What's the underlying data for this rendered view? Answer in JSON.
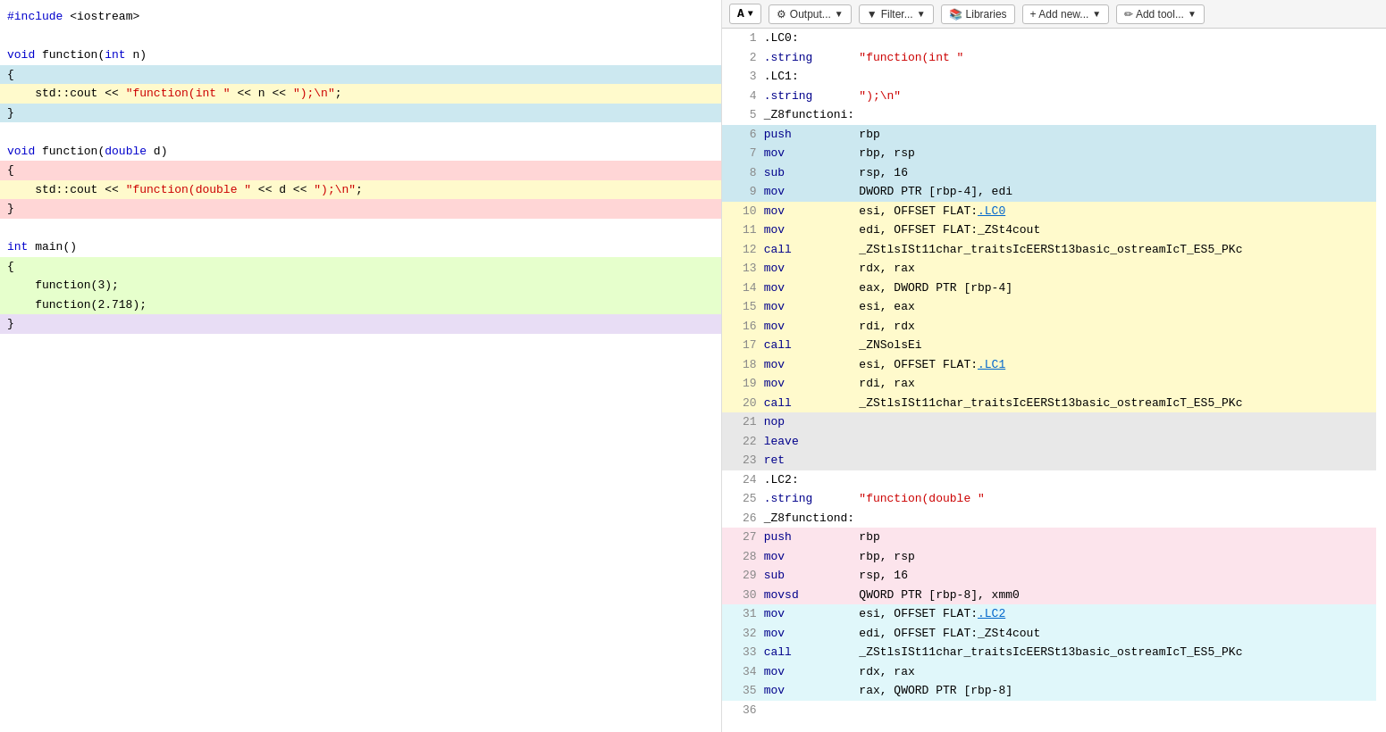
{
  "left": {
    "lines": [
      {
        "text": "#include <iostream>",
        "highlight": "",
        "parts": [
          {
            "t": "#include ",
            "cls": "kw"
          },
          {
            "t": "<iostream>",
            "cls": "plain"
          }
        ]
      },
      {
        "text": "",
        "highlight": ""
      },
      {
        "text": "void function(int n)",
        "highlight": "",
        "parts": [
          {
            "t": "void ",
            "cls": "kw"
          },
          {
            "t": "function(",
            "cls": "plain"
          },
          {
            "t": "int",
            "cls": "kw"
          },
          {
            "t": " n)",
            "cls": "plain"
          }
        ]
      },
      {
        "text": "{",
        "highlight": "hl-blue"
      },
      {
        "text": "    std::cout << \"function(int \" << n << \");\\n\";",
        "highlight": "hl-yellow",
        "parts": [
          {
            "t": "    std::cout << ",
            "cls": "plain"
          },
          {
            "t": "\"function(int \"",
            "cls": "str"
          },
          {
            "t": " << n << ",
            "cls": "plain"
          },
          {
            "t": "\");\\n\"",
            "cls": "str"
          },
          {
            "t": ";",
            "cls": "plain"
          }
        ]
      },
      {
        "text": "}",
        "highlight": "hl-blue"
      },
      {
        "text": "",
        "highlight": ""
      },
      {
        "text": "void function(double d)",
        "highlight": "",
        "parts": [
          {
            "t": "void ",
            "cls": "kw"
          },
          {
            "t": "function(",
            "cls": "plain"
          },
          {
            "t": "double",
            "cls": "kw"
          },
          {
            "t": " d)",
            "cls": "plain"
          }
        ]
      },
      {
        "text": "{",
        "highlight": "hl-red"
      },
      {
        "text": "    std::cout << \"function(double \" << d << \");\\n\";",
        "highlight": "hl-yellow",
        "parts": [
          {
            "t": "    std::cout << ",
            "cls": "plain"
          },
          {
            "t": "\"function(double \"",
            "cls": "str"
          },
          {
            "t": " << d << ",
            "cls": "plain"
          },
          {
            "t": "\");\\n\"",
            "cls": "str"
          },
          {
            "t": ";",
            "cls": "plain"
          }
        ]
      },
      {
        "text": "}",
        "highlight": "hl-red"
      },
      {
        "text": "",
        "highlight": ""
      },
      {
        "text": "int main()",
        "highlight": "",
        "parts": [
          {
            "t": "int ",
            "cls": "kw"
          },
          {
            "t": "main()",
            "cls": "plain"
          }
        ]
      },
      {
        "text": "{",
        "highlight": "hl-green"
      },
      {
        "text": "    function(3);",
        "highlight": "hl-green"
      },
      {
        "text": "    function(2.718);",
        "highlight": "hl-green"
      },
      {
        "text": "}",
        "highlight": "hl-purple"
      }
    ]
  },
  "toolbar": {
    "font_label": "A",
    "output_label": "Output...",
    "filter_label": "Filter...",
    "libraries_label": "Libraries",
    "add_new_label": "+ Add new...",
    "add_tool_label": "✏ Add tool..."
  },
  "asm": {
    "rows": [
      {
        "num": 1,
        "label": ".LC0:",
        "instr": "",
        "ops": "",
        "hl": ""
      },
      {
        "num": 2,
        "label": "",
        "instr": ".string",
        "ops": "\"function(int \"",
        "hl": "",
        "ops_is_str": true
      },
      {
        "num": 3,
        "label": ".LC1:",
        "instr": "",
        "ops": "",
        "hl": ""
      },
      {
        "num": 4,
        "label": "",
        "instr": ".string",
        "ops": "\");\\n\"",
        "hl": "",
        "ops_is_str": true
      },
      {
        "num": 5,
        "label": "_Z8functioni:",
        "instr": "",
        "ops": "",
        "hl": ""
      },
      {
        "num": 6,
        "label": "",
        "instr": "push",
        "ops": "rbp",
        "hl": "asm-hl-blue"
      },
      {
        "num": 7,
        "label": "",
        "instr": "mov",
        "ops": "rbp, rsp",
        "hl": "asm-hl-blue"
      },
      {
        "num": 8,
        "label": "",
        "instr": "sub",
        "ops": "rsp, 16",
        "hl": "asm-hl-blue"
      },
      {
        "num": 9,
        "label": "",
        "instr": "mov",
        "ops": "DWORD PTR [rbp-4], edi",
        "hl": "asm-hl-blue"
      },
      {
        "num": 10,
        "label": "",
        "instr": "mov",
        "ops": "esi, OFFSET FLAT:.LC0",
        "hl": "asm-hl-yellow",
        "link_in_ops": true,
        "link_text": ".LC0",
        "link_pos": "after_flat"
      },
      {
        "num": 11,
        "label": "",
        "instr": "mov",
        "ops": "edi, OFFSET FLAT:_ZSt4cout",
        "hl": "asm-hl-yellow"
      },
      {
        "num": 12,
        "label": "",
        "instr": "call",
        "ops": "_ZStlsISt11char_traitsIcEERSt13basic_ostreamIcT_ES5_PKc",
        "hl": "asm-hl-yellow"
      },
      {
        "num": 13,
        "label": "",
        "instr": "mov",
        "ops": "rdx, rax",
        "hl": "asm-hl-yellow"
      },
      {
        "num": 14,
        "label": "",
        "instr": "mov",
        "ops": "eax, DWORD PTR [rbp-4]",
        "hl": "asm-hl-yellow"
      },
      {
        "num": 15,
        "label": "",
        "instr": "mov",
        "ops": "esi, eax",
        "hl": "asm-hl-yellow"
      },
      {
        "num": 16,
        "label": "",
        "instr": "mov",
        "ops": "rdi, rdx",
        "hl": "asm-hl-yellow"
      },
      {
        "num": 17,
        "label": "",
        "instr": "call",
        "ops": "_ZNSolsEi",
        "hl": "asm-hl-yellow"
      },
      {
        "num": 18,
        "label": "",
        "instr": "mov",
        "ops": "esi, OFFSET FLAT:.LC1",
        "hl": "asm-hl-yellow",
        "link_in_ops": true,
        "link_text": ".LC1"
      },
      {
        "num": 19,
        "label": "",
        "instr": "mov",
        "ops": "rdi, rax",
        "hl": "asm-hl-yellow"
      },
      {
        "num": 20,
        "label": "",
        "instr": "call",
        "ops": "_ZStlsISt11char_traitsIcEERSt13basic_ostreamIcT_ES5_PKc",
        "hl": "asm-hl-yellow"
      },
      {
        "num": 21,
        "label": "",
        "instr": "nop",
        "ops": "",
        "hl": "asm-hl-gray"
      },
      {
        "num": 22,
        "label": "",
        "instr": "leave",
        "ops": "",
        "hl": "asm-hl-gray"
      },
      {
        "num": 23,
        "label": "",
        "instr": "ret",
        "ops": "",
        "hl": "asm-hl-gray"
      },
      {
        "num": 24,
        "label": ".LC2:",
        "instr": "",
        "ops": "",
        "hl": ""
      },
      {
        "num": 25,
        "label": "",
        "instr": ".string",
        "ops": "\"function(double \"",
        "hl": "",
        "ops_is_str": true
      },
      {
        "num": 26,
        "label": "_Z8functiond:",
        "instr": "",
        "ops": "",
        "hl": ""
      },
      {
        "num": 27,
        "label": "",
        "instr": "push",
        "ops": "rbp",
        "hl": "asm-hl-pink"
      },
      {
        "num": 28,
        "label": "",
        "instr": "mov",
        "ops": "rbp, rsp",
        "hl": "asm-hl-pink"
      },
      {
        "num": 29,
        "label": "",
        "instr": "sub",
        "ops": "rsp, 16",
        "hl": "asm-hl-pink"
      },
      {
        "num": 30,
        "label": "",
        "instr": "movsd",
        "ops": "QWORD PTR [rbp-8], xmm0",
        "hl": "asm-hl-pink"
      },
      {
        "num": 31,
        "label": "",
        "instr": "mov",
        "ops": "esi, OFFSET FLAT:.LC2",
        "hl": "asm-hl-teal",
        "link_in_ops": true,
        "link_text": ".LC2"
      },
      {
        "num": 32,
        "label": "",
        "instr": "mov",
        "ops": "edi, OFFSET FLAT:_ZSt4cout",
        "hl": "asm-hl-teal"
      },
      {
        "num": 33,
        "label": "",
        "instr": "call",
        "ops": "_ZStlsISt11char_traitsIcEERSt13basic_ostreamIcT_ES5_PKc",
        "hl": "asm-hl-teal"
      },
      {
        "num": 34,
        "label": "",
        "instr": "mov",
        "ops": "rdx, rax",
        "hl": "asm-hl-teal"
      },
      {
        "num": 35,
        "label": "",
        "instr": "mov",
        "ops": "rax, QWORD PTR [rbp-8]",
        "hl": "asm-hl-teal"
      },
      {
        "num": 36,
        "label": "",
        "instr": "",
        "ops": "",
        "hl": ""
      }
    ]
  }
}
